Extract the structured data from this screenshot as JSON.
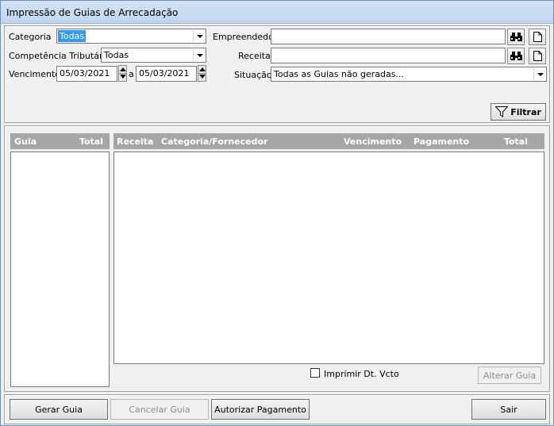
{
  "window": {
    "title": "Impressão de Guias de Arrecadação"
  },
  "filters": {
    "categoria": {
      "label": "Categoria",
      "value": "Todas"
    },
    "competencia": {
      "label": "Competência Tributária",
      "value": "Todas"
    },
    "vencimento": {
      "label": "Vencimento",
      "from": "05/03/2021",
      "sep": "a",
      "to": "05/03/2021"
    },
    "empreendedor": {
      "label": "Empreendedor",
      "value": ""
    },
    "receita": {
      "label": "Receita",
      "value": ""
    },
    "situacao": {
      "label": "Situação",
      "value": "Todas as Guias não geradas..."
    },
    "filtrar_label": "Filtrar"
  },
  "left_table": {
    "columns": [
      "Guia",
      "Total"
    ],
    "rows": []
  },
  "main_table": {
    "columns": [
      "Receita",
      "Categoria/Fornecedor",
      "Vencimento",
      "Pagamento",
      "Total"
    ],
    "rows": []
  },
  "options": {
    "imprimir_label": "Imprimir Dt. Vcto",
    "imprimir_checked": false
  },
  "buttons": {
    "alterar": "Alterar Guia",
    "gerar": "Gerar Guia",
    "cancelar": "Cancelar Guia",
    "autorizar": "Autorizar Pagamento",
    "sair": "Sair"
  }
}
